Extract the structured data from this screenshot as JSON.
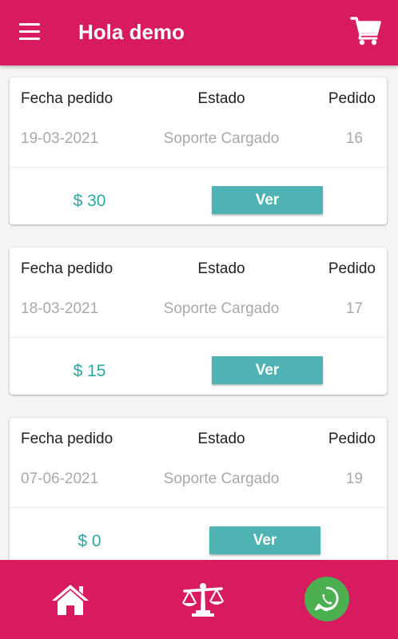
{
  "header": {
    "title": "Hola demo",
    "menu_icon": "hamburger-menu-icon",
    "cart_icon": "shopping-cart-icon"
  },
  "orders": [
    {
      "date_label": "Fecha pedido",
      "status_label": "Estado",
      "order_label": "Pedido",
      "date": "19-03-2021",
      "status": "Soporte Cargado",
      "order_number": "16",
      "price": "$ 30",
      "button_label": "Ver"
    },
    {
      "date_label": "Fecha pedido",
      "status_label": "Estado",
      "order_label": "Pedido",
      "date": "18-03-2021",
      "status": "Soporte Cargado",
      "order_number": "17",
      "price": "$ 15",
      "button_label": "Ver"
    },
    {
      "date_label": "Fecha pedido",
      "status_label": "Estado",
      "order_label": "Pedido",
      "date": "07-06-2021",
      "status": "Soporte Cargado",
      "order_number": "19",
      "price": "$ 0",
      "button_label": "Ver"
    }
  ],
  "bottom_nav": {
    "items": [
      "home-icon",
      "scale-balance-icon",
      "whatsapp-icon"
    ]
  },
  "colors": {
    "primary": "#d81b60",
    "accent": "#4fb3b3",
    "price": "#2aa9a3",
    "whatsapp": "#4caf50"
  }
}
